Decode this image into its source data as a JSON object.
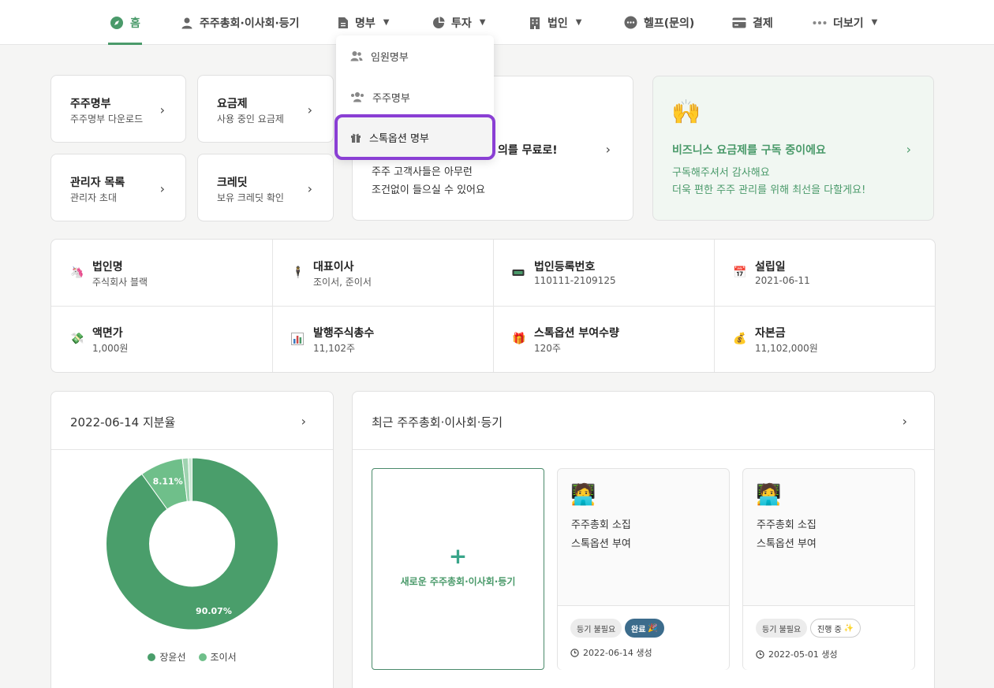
{
  "nav": {
    "items": [
      {
        "label": "홈",
        "icon": "compass-icon"
      },
      {
        "label": "주주총회·이사회·등기",
        "icon": "person-icon"
      },
      {
        "label": "명부",
        "icon": "document-icon"
      },
      {
        "label": "투자",
        "icon": "pie-chart-icon"
      },
      {
        "label": "법인",
        "icon": "building-icon"
      },
      {
        "label": "헬프(문의)",
        "icon": "chat-icon"
      },
      {
        "label": "결제",
        "icon": "credit-card-icon"
      },
      {
        "label": "더보기",
        "icon": "more-dots-icon"
      }
    ],
    "active_color": "#4a9a6a"
  },
  "dropdown": {
    "items": [
      {
        "label": "임원명부",
        "icon": "people-icon"
      },
      {
        "label": "주주명부",
        "icon": "group-icon"
      },
      {
        "label": "스톡옵션 명부",
        "icon": "gift-icon"
      }
    ],
    "highlight_color": "#8a3fd4"
  },
  "quick": [
    {
      "title": "주주명부",
      "sub": "주주명부 다운로드"
    },
    {
      "title": "요금제",
      "sub": "사용 중인 요금제"
    },
    {
      "title": "관리자 목록",
      "sub": "관리자 초대"
    },
    {
      "title": "크레딧",
      "sub": "보유 크레딧 확인"
    }
  ],
  "promo": {
    "title": "의를 무료로!",
    "line1": "주주 고객사들은 아무런",
    "line2": "조건없이 들으실 수 있어요"
  },
  "business": {
    "emoji": "🙌",
    "title": "비즈니스 요금제를 구독 중이에요",
    "line1": "구독해주셔서 감사해요",
    "line2": "더욱 편한 주주 관리를 위해 최선을 다할게요!",
    "color": "#4a9a6a"
  },
  "info": [
    {
      "label": "법인명",
      "value": "주식회사 블랙",
      "icon": "unicorn-icon"
    },
    {
      "label": "대표이사",
      "value": "조이서, 준이서",
      "icon": "businessman-icon"
    },
    {
      "label": "법인등록번호",
      "value": "110111-2109125",
      "icon": "id-card-icon"
    },
    {
      "label": "설립일",
      "value": "2021-06-11",
      "icon": "calendar-icon"
    },
    {
      "label": "액면가",
      "value": "1,000원",
      "icon": "money-icon"
    },
    {
      "label": "발행주식총수",
      "value": "11,102주",
      "icon": "bar-chart-icon"
    },
    {
      "label": "스톡옵션 부여수량",
      "value": "120주",
      "icon": "gift-box-icon"
    },
    {
      "label": "자본금",
      "value": "11,102,000원",
      "icon": "money-bag-icon"
    }
  ],
  "equity": {
    "title": "2022-06-14 지분율"
  },
  "chart_data": {
    "type": "pie",
    "series": [
      {
        "name": "장윤선",
        "value": 90.07,
        "color": "#4a9e6b"
      },
      {
        "name": "조이서",
        "value": 8.11,
        "color": "#6fbf8a"
      },
      {
        "name": "",
        "value": 1.1,
        "color": "#9fd3b0"
      },
      {
        "name": "",
        "value": 0.72,
        "color": "#c9e7d2"
      }
    ],
    "data_labels": [
      "90.07%",
      "8.11%"
    ],
    "legend": [
      "장윤선",
      "조이서"
    ],
    "legend_position": "bottom"
  },
  "meetings": {
    "title": "최근 주주총회·이사회·등기",
    "new_label": "새로운 주주총회·이사회·등기",
    "cards": [
      {
        "emoji": "🧑‍💻",
        "line1": "주주총회 소집",
        "line2": "스톡옵션 부여",
        "pill1": "등기 불필요",
        "pill2": "완료",
        "pill2_emoji": "🎉",
        "date": "2022-06-14 생성"
      },
      {
        "emoji": "🧑‍💻",
        "line1": "주주총회 소집",
        "line2": "스톡옵션 부여",
        "pill1": "등기 불필요",
        "pill2": "진행 중",
        "pill2_emoji": "✨",
        "date": "2022-05-01 생성"
      }
    ]
  }
}
